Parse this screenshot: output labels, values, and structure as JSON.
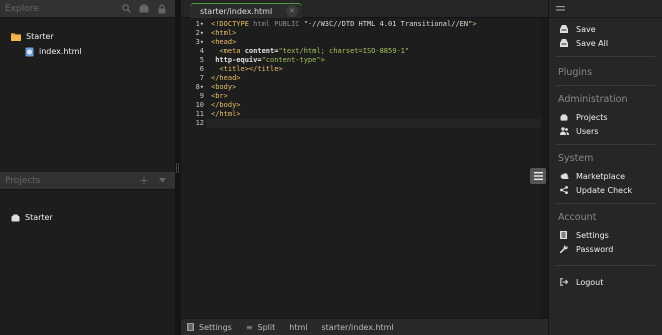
{
  "explore": {
    "title": "Explore",
    "tree": [
      {
        "label": "Starter",
        "type": "folder"
      },
      {
        "label": "index.html",
        "type": "file"
      }
    ]
  },
  "projects": {
    "title": "Projects",
    "items": [
      {
        "label": "Starter"
      }
    ]
  },
  "editor": {
    "tab": {
      "prefix": "starter/",
      "file": "index.html"
    },
    "line_numbers": [
      "1",
      "2",
      "3",
      "4",
      "5",
      "6",
      "7",
      "8",
      "9",
      "10",
      "11",
      "12"
    ],
    "lines": [
      [
        {
          "t": "<!DOCTYPE ",
          "c": "tag"
        },
        {
          "t": "html PUBLIC ",
          "c": "dim"
        },
        {
          "t": "\"-//W3C//DTD HTML 4.01 Transitional//EN\"",
          "c": "txt"
        },
        {
          "t": ">",
          "c": "tag"
        }
      ],
      [
        {
          "t": "<html>",
          "c": "tag"
        }
      ],
      [
        {
          "t": "<head>",
          "c": "tag"
        }
      ],
      [
        {
          "t": "  <meta ",
          "c": "tag"
        },
        {
          "t": "content=",
          "c": "attr"
        },
        {
          "t": "\"text/html; charset=ISO-8859-1\"",
          "c": "str"
        }
      ],
      [
        {
          "t": " http-equiv=",
          "c": "attr"
        },
        {
          "t": "\"content-type\"",
          "c": "str"
        },
        {
          "t": ">",
          "c": "tag"
        }
      ],
      [
        {
          "t": "  <title></title>",
          "c": "tag"
        }
      ],
      [
        {
          "t": "</head>",
          "c": "tag"
        }
      ],
      [
        {
          "t": "<body>",
          "c": "tag"
        }
      ],
      [
        {
          "t": "<br>",
          "c": "tag"
        }
      ],
      [
        {
          "t": "</body>",
          "c": "tag"
        }
      ],
      [
        {
          "t": "</html>",
          "c": "tag"
        }
      ],
      [
        {
          "t": "",
          "c": "txt"
        }
      ]
    ],
    "colors": {
      "tag": "#e8bf6a",
      "string": "#a5c25c",
      "accent": "#4e9a3e"
    }
  },
  "statusbar": {
    "settings": "Settings",
    "split": "Split",
    "mode": "html",
    "path": "starter/index.html"
  },
  "menu": {
    "save": "Save",
    "save_all": "Save All",
    "plugins": "Plugins",
    "administration": "Administration",
    "projects": "Projects",
    "users": "Users",
    "system": "System",
    "marketplace": "Marketplace",
    "update_check": "Update Check",
    "account": "Account",
    "settings": "Settings",
    "password": "Password",
    "logout": "Logout"
  }
}
